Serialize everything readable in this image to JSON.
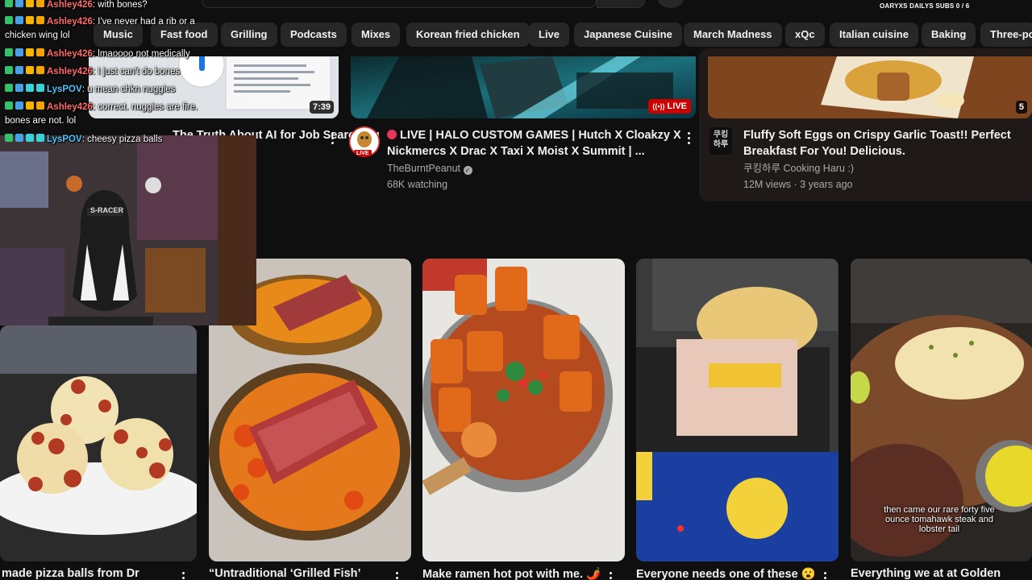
{
  "header": {
    "subs_counter": "OARYXS DAILYS SUBS 0 / 6"
  },
  "chips": [
    "Music",
    "Fast food",
    "Grilling",
    "Podcasts",
    "Mixes",
    "Korean fried chicken",
    "Live",
    "Japanese Cuisine",
    "March Madness",
    "xQc",
    "Italian cuisine",
    "Baking",
    "Three-po"
  ],
  "videos": [
    {
      "title": "The Truth About AI for Job Searching",
      "duration": "7:39"
    },
    {
      "title_line1": "LIVE | HALO CUSTOM GAMES | Hutch X Cloakzy X",
      "title_line2": "Nickmercs X Drac X Taxi X Moist X Summit | ...",
      "channel": "TheBurntPeanut",
      "meta": "68K watching",
      "badge": "LIVE",
      "avatar_badge": "LIVE"
    },
    {
      "title_line1": "Fluffy Soft Eggs on Crispy Garlic Toast!! Perfect",
      "title_line2": "Breakfast For You! Delicious.",
      "channel": "쿠킹하루 Cooking Haru :)",
      "meta": "12M views · 3 years ago",
      "avatar_text": "쿠킹\n하루",
      "duration": "5"
    }
  ],
  "shorts": [
    {
      "title": "made pizza balls from Dr"
    },
    {
      "title": "“Untraditional ‘Grilled Fish’"
    },
    {
      "title": "Make ramen hot pot with me. 🌶️"
    },
    {
      "title": "Everyone needs one of these 😮"
    },
    {
      "title": "Everything we at at Golden",
      "caption": "then came our rare forty five ounce tomahawk steak and lobster tail"
    }
  ],
  "chat": [
    {
      "user": "Ashley426",
      "msg": ": with bones?"
    },
    {
      "user": "Ashley426",
      "msg": ": I've never had a rib or a"
    },
    {
      "user": "",
      "msg": "chicken wing lol"
    },
    {
      "user": "Ashley426",
      "msg": ": lmaoooo not medically"
    },
    {
      "user": "Ashley426",
      "msg": ": I just can't do bones"
    },
    {
      "user": "LysPOV",
      "msg": ": u mean chkn nuggies"
    },
    {
      "user": "Ashley426",
      "msg": ": correct. nuggies are fire."
    },
    {
      "user": "",
      "msg": "bones are not. lol"
    },
    {
      "user": "LysPOV",
      "msg": ": cheesy pizza balls"
    }
  ],
  "colors": {
    "background": "#0f0f0f",
    "chip_bg": "#272727",
    "live_red": "#cc0000",
    "chat_name": "#ff6b6b",
    "chat_name_alt": "#4fc3f7"
  }
}
